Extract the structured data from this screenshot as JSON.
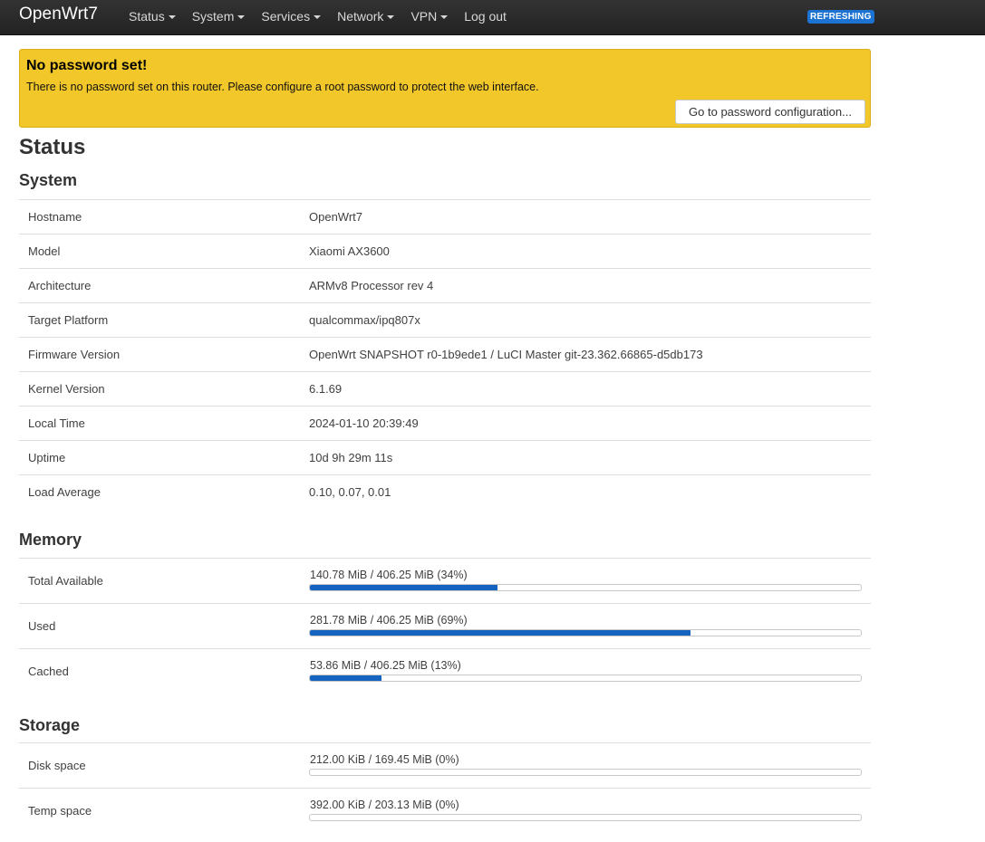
{
  "navbar": {
    "brand": "OpenWrt7",
    "menu": [
      "Status",
      "System",
      "Services",
      "Network",
      "VPN"
    ],
    "logout": "Log out",
    "refreshing_badge": "REFRESHING"
  },
  "alert": {
    "title": "No password set!",
    "text": "There is no password set on this router. Please configure a root password to protect the web interface.",
    "button": "Go to password configuration..."
  },
  "page": {
    "title": "Status"
  },
  "system": {
    "heading": "System",
    "rows": [
      {
        "key": "Hostname",
        "value": "OpenWrt7"
      },
      {
        "key": "Model",
        "value": "Xiaomi AX3600"
      },
      {
        "key": "Architecture",
        "value": "ARMv8 Processor rev 4"
      },
      {
        "key": "Target Platform",
        "value": "qualcommax/ipq807x"
      },
      {
        "key": "Firmware Version",
        "value": "OpenWrt SNAPSHOT r0-1b9ede1 / LuCI Master git-23.362.66865-d5db173"
      },
      {
        "key": "Kernel Version",
        "value": "6.1.69"
      },
      {
        "key": "Local Time",
        "value": "2024-01-10 20:39:49"
      },
      {
        "key": "Uptime",
        "value": "10d 9h 29m 11s"
      },
      {
        "key": "Load Average",
        "value": "0.10, 0.07, 0.01"
      }
    ]
  },
  "memory": {
    "heading": "Memory",
    "rows": [
      {
        "key": "Total Available",
        "label": "140.78 MiB / 406.25 MiB (34%)",
        "percent": 34
      },
      {
        "key": "Used",
        "label": "281.78 MiB / 406.25 MiB (69%)",
        "percent": 69
      },
      {
        "key": "Cached",
        "label": "53.86 MiB / 406.25 MiB (13%)",
        "percent": 13
      }
    ]
  },
  "storage": {
    "heading": "Storage",
    "rows": [
      {
        "key": "Disk space",
        "label": "212.00 KiB / 169.45 MiB (0%)",
        "percent": 0
      },
      {
        "key": "Temp space",
        "label": "392.00 KiB / 203.13 MiB (0%)",
        "percent": 0
      }
    ]
  },
  "colors": {
    "navbar": "#222222",
    "alert": "#f2c72a",
    "bar_fill": "#1565c0",
    "badge": "#1c73d1"
  }
}
